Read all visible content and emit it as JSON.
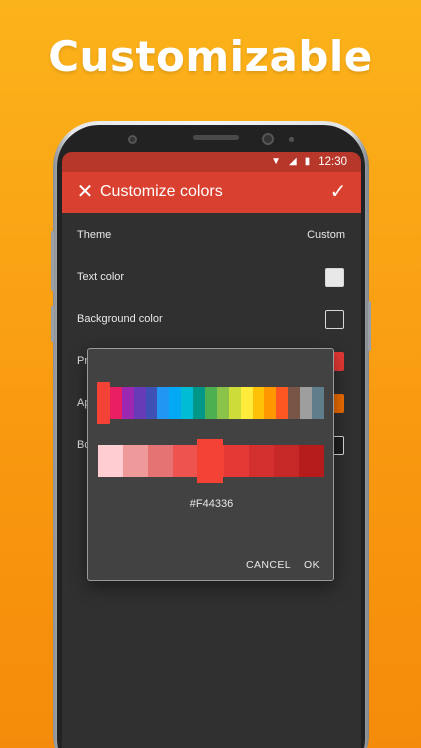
{
  "headline": "Customizable",
  "status_bar": {
    "time": "12:30"
  },
  "toolbar": {
    "title": "Customize colors"
  },
  "settings": {
    "theme": {
      "label": "Theme",
      "value": "Custom"
    },
    "text_color": {
      "label": "Text color",
      "swatch": "#E8E8E8"
    },
    "background_color": {
      "label": "Background color",
      "swatch": "#303030"
    },
    "primary_color": {
      "label": "Pr",
      "swatch": "#E53935"
    },
    "accent_color": {
      "label": "Ap",
      "swatch": "#EF6C00"
    },
    "border_color": {
      "label": "Bo",
      "swatch": "#1E1E1E"
    }
  },
  "dialog": {
    "hue_colors": [
      "#F44336",
      "#E91E63",
      "#9C27B0",
      "#673AB7",
      "#3F51B5",
      "#2196F3",
      "#03A9F4",
      "#00BCD4",
      "#009688",
      "#4CAF50",
      "#8BC34A",
      "#CDDC39",
      "#FFEB3B",
      "#FFC107",
      "#FF9800",
      "#FF5722",
      "#795548",
      "#9E9E9E",
      "#607D8B"
    ],
    "shade_colors": [
      "#FFCDD2",
      "#EF9A9A",
      "#E57373",
      "#EF5350",
      "#F44336",
      "#E53935",
      "#D32F2F",
      "#C62828",
      "#B71C1C"
    ],
    "selected_color": "#F44336",
    "hex": "#F44336",
    "cancel_label": "CANCEL",
    "ok_label": "OK"
  }
}
